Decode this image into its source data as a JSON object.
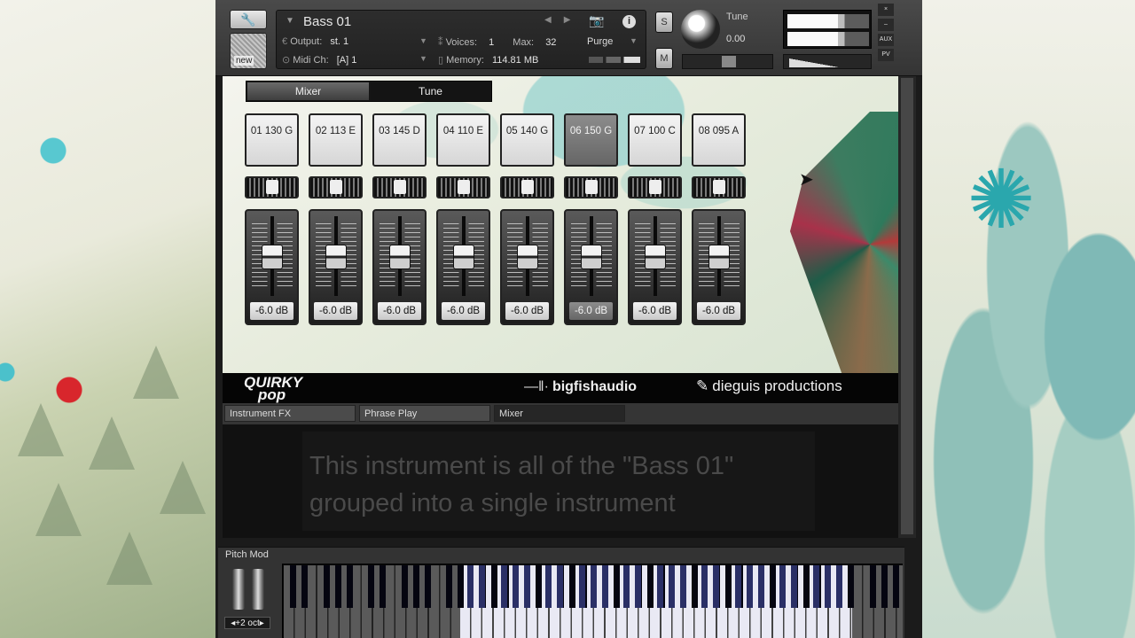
{
  "header": {
    "instrument_name": "Bass 01",
    "output_label": "Output:",
    "output_value": "st. 1",
    "voices_label": "Voices:",
    "voices_value": "1",
    "max_label": "Max:",
    "max_value": "32",
    "purge_label": "Purge",
    "midi_label": "Midi Ch:",
    "midi_value": "[A]  1",
    "memory_label": "Memory:",
    "memory_value": "114.81 MB",
    "new_label": "new",
    "solo_label": "S",
    "mute_label": "M",
    "tune_label": "Tune",
    "tune_value": "0.00",
    "side_labels": [
      "×",
      "–",
      "AUX",
      "PV"
    ]
  },
  "stage": {
    "tabs": [
      "Mixer",
      "Tune"
    ],
    "active_tab": "Mixer",
    "channels": [
      {
        "name": "01 130 G",
        "db": "-6.0 dB",
        "active": false
      },
      {
        "name": "02 113 E",
        "db": "-6.0 dB",
        "active": false
      },
      {
        "name": "03 145 D",
        "db": "-6.0 dB",
        "active": false
      },
      {
        "name": "04 110 E",
        "db": "-6.0 dB",
        "active": false
      },
      {
        "name": "05 140 G",
        "db": "-6.0 dB",
        "active": false
      },
      {
        "name": "06 150 G",
        "db": "-6.0 dB",
        "active": true
      },
      {
        "name": "07 100 C",
        "db": "-6.0 dB",
        "active": false
      },
      {
        "name": "08 095 A",
        "db": "-6.0 dB",
        "active": false
      }
    ]
  },
  "logos": {
    "quirky_line1": "QUIRKY",
    "quirky_line2": "pop",
    "bigfish": "bigfishaudio",
    "dieguis": "dieguis productions"
  },
  "bottom_tabs": [
    "Instrument FX",
    "Phrase Play",
    "Mixer"
  ],
  "active_bottom_tab": "Mixer",
  "caption": {
    "line1": "This instrument is all of the \"Bass 01\"",
    "line2": "grouped into a single instrument"
  },
  "keyboard": {
    "pitch_label": "Pitch Mod",
    "octave_label": "+2 oct"
  },
  "colors": {
    "active_channel": "#777777",
    "key_range": "#e9e9f4",
    "key_range_black": "#2a2f66"
  }
}
